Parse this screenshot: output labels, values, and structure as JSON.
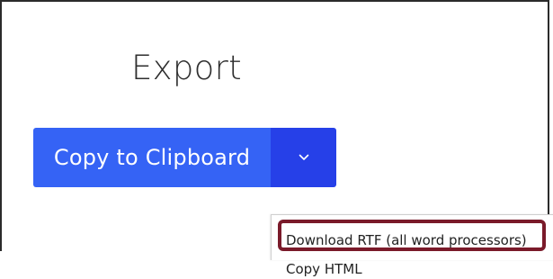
{
  "export_panel": {
    "title": "Export",
    "copy_button_label": "Copy to Clipboard",
    "dropdown_toggle_icon": "chevron-down-icon"
  },
  "export_menu": {
    "items": [
      {
        "label": "Download RTF (all word processors)"
      },
      {
        "label": "Copy HTML"
      }
    ]
  },
  "colors": {
    "primary_button": "#3563f5",
    "toggle_button": "#2640e8",
    "highlight_outline": "#7a1a2a"
  }
}
